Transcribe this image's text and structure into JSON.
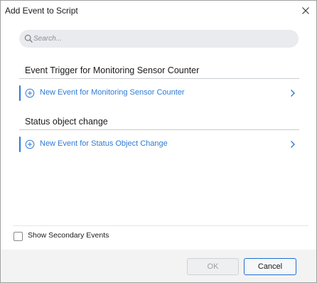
{
  "window": {
    "title": "Add Event to Script"
  },
  "search": {
    "placeholder": "Search..."
  },
  "groups": [
    {
      "heading": "Event Trigger for Monitoring Sensor Counter",
      "item_label": "New Event for Monitoring Sensor Counter"
    },
    {
      "heading": "Status object change",
      "item_label": "New Event for Status Object Change"
    }
  ],
  "options": {
    "show_secondary_label": "Show Secondary Events",
    "show_secondary_checked": false
  },
  "buttons": {
    "ok_label": "OK",
    "ok_enabled": false,
    "cancel_label": "Cancel"
  },
  "colors": {
    "accent": "#2f7bd3",
    "footer_bg": "#f3f3f3",
    "search_bg": "#e9ebee"
  }
}
